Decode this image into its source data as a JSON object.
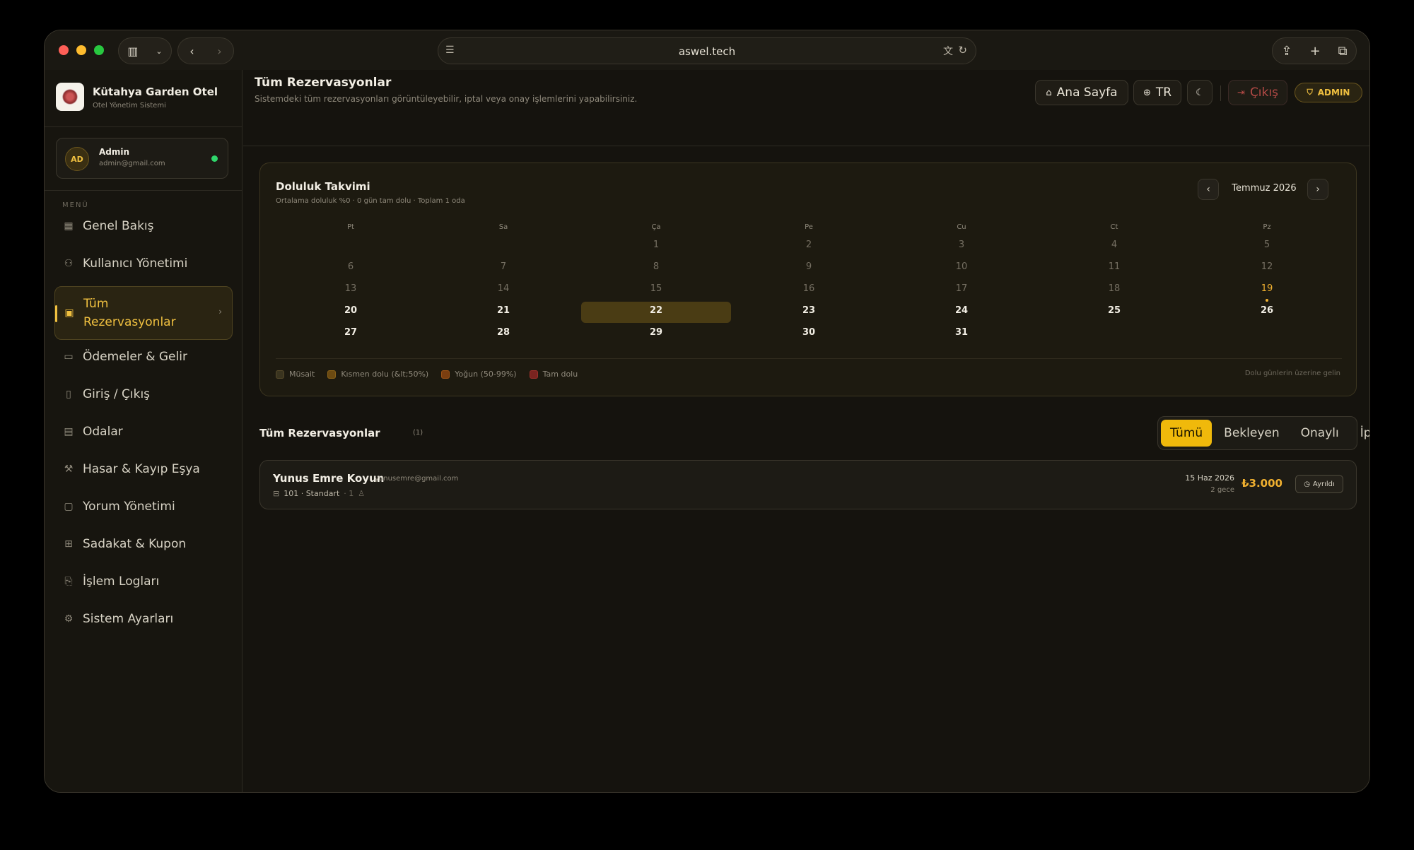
{
  "browser": {
    "url": "aswel.tech"
  },
  "brand": {
    "name": "Kütahya Garden Otel",
    "subtitle": "Otel Yönetim Sistemi"
  },
  "user": {
    "initials": "AD",
    "name": "Admin",
    "email": "admin@gmail.com"
  },
  "menu": {
    "label": "MENÜ",
    "items": [
      {
        "label": "Genel Bakış",
        "icon": "grid-icon"
      },
      {
        "label": "Kullanıcı Yönetimi",
        "icon": "users-icon"
      },
      {
        "label": "Tüm Rezervasyonlar",
        "icon": "calendar-check-icon",
        "active": true
      },
      {
        "label": "Ödemeler & Gelir",
        "icon": "credit-card-icon"
      },
      {
        "label": "Giriş / Çıkış",
        "icon": "door-icon"
      },
      {
        "label": "Odalar",
        "icon": "building-icon"
      },
      {
        "label": "Hasar & Kayıp Eşya",
        "icon": "wrench-icon"
      },
      {
        "label": "Yorum Yönetimi",
        "icon": "message-icon"
      },
      {
        "label": "Sadakat & Kupon",
        "icon": "gift-icon"
      },
      {
        "label": "İşlem Logları",
        "icon": "log-icon"
      },
      {
        "label": "Sistem Ayarları",
        "icon": "gear-icon"
      }
    ]
  },
  "header": {
    "title": "Tüm Rezervasyonlar",
    "subtitle": "Sistemdeki tüm rezervasyonları görüntüleyebilir, iptal veya onay işlemlerini yapabilirsiniz.",
    "home_label": "Ana Sayfa",
    "lang_label": "TR",
    "exit_label": "Çıkış",
    "role_label": "ADMIN"
  },
  "calendar": {
    "title": "Doluluk Takvimi",
    "subtitle": "Ortalama doluluk %0 · 0 gün tam dolu · Toplam 1 oda",
    "month": "Temmuz 2026",
    "weekdays": [
      "Pt",
      "Sa",
      "Ça",
      "Pe",
      "Cu",
      "Ct",
      "Pz"
    ],
    "weeks": [
      [
        "",
        "",
        "1",
        "2",
        "3",
        "4",
        "5"
      ],
      [
        "6",
        "7",
        "8",
        "9",
        "10",
        "11",
        "12"
      ],
      [
        "13",
        "14",
        "15",
        "16",
        "17",
        "18",
        "19"
      ],
      [
        "20",
        "21",
        "22",
        "23",
        "24",
        "25",
        "26"
      ],
      [
        "27",
        "28",
        "29",
        "30",
        "31",
        "",
        ""
      ]
    ],
    "today": "22",
    "marked": "19",
    "first_current_day": 20,
    "legend": [
      {
        "label": "Müsait",
        "color": "#3a341f"
      },
      {
        "label": "Kısmen dolu (&lt;50%)",
        "color": "#6b4a12"
      },
      {
        "label": "Yoğun (50-99%)",
        "color": "#7a3e10"
      },
      {
        "label": "Tam dolu",
        "color": "#7a2420"
      }
    ],
    "hint": "Dolu günlerin üzerine gelin"
  },
  "reservations": {
    "title": "Tüm Rezervasyonlar",
    "count": "(1)",
    "filters": [
      {
        "label": "Tümü",
        "active": true
      },
      {
        "label": "Bekleyen",
        "active": false
      },
      {
        "label": "Onaylı",
        "active": false
      },
      {
        "label": "İptal",
        "active": false
      }
    ],
    "items": [
      {
        "guest": "Yunus Emre Koyun",
        "email": "yunusemre@gmail.com",
        "room": "101 · Standart",
        "guests": "· 1",
        "date": "15 Haz 2026",
        "nights": "2 gece",
        "price": "₺3.000",
        "status": "Ayrıldı"
      }
    ]
  },
  "colors": {
    "accent": "#f0b90b",
    "online": "#2fd66b",
    "danger": "#b44a46"
  }
}
